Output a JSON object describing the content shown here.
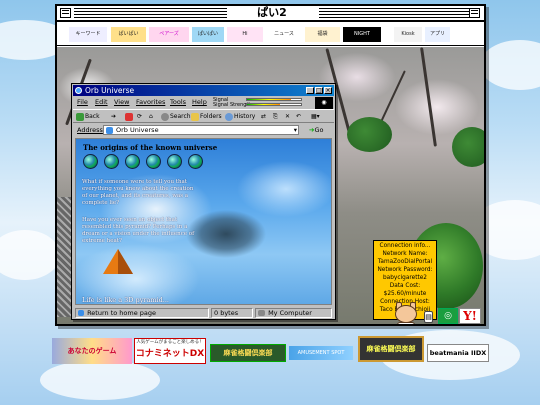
{
  "window": {
    "title": "ぱい2"
  },
  "top_banners": [
    "キーワード",
    "ぱいぱい",
    "ペアーズ",
    "ぱいぱい",
    "Hi",
    "ニュース",
    "福袋",
    "NIGHT",
    "Kiosk",
    "アプリ"
  ],
  "browser": {
    "title": "Orb Universe",
    "menu": [
      "File",
      "Edit",
      "View",
      "Favorites",
      "Tools",
      "Help"
    ],
    "signal": {
      "label1": "Signal",
      "label2": "Signal Strength",
      "signal_level": 0.82,
      "strength_level": 0.62
    },
    "toolbar": {
      "back": "Back",
      "stop": "",
      "search": "Search",
      "folders": "Folders",
      "history": "History"
    },
    "address": {
      "label": "Address",
      "value": "Orb Universe",
      "go": "Go"
    },
    "content": {
      "heading": "The origins of the known universe",
      "globe_count": 6,
      "paragraphs": [
        "What if someone were to tell you that everything you knew about the creation of our planet, and its creatures, was a complete lie?",
        "Have you ever seen an object that resembled this pyramid? Perhaps in a dream or a vision under the influence of extreme heat?",
        "Life is like a 3D pyramid..."
      ]
    },
    "status": {
      "home": "Return to home page",
      "bytes": "0 bytes",
      "zone": "My Computer"
    }
  },
  "info_box": {
    "lines": [
      "Connection info...",
      "Network Name:",
      "TamaZooDialPortal",
      "Network Password:",
      "babycigarette2",
      "Data Cost:",
      "$25.60/minute",
      "Connection Host:",
      "Taco Bell Hachioji"
    ]
  },
  "bottom_ads": [
    {
      "label": "あなたのゲーム"
    },
    {
      "label": "人気ゲームがまるごと楽しめる！",
      "sub": "コナミネットDX"
    },
    {
      "label": "麻雀格闘倶楽部"
    },
    {
      "label": "AMUSEMENT SPOT"
    },
    {
      "label": "麻雀格闘倶楽部"
    },
    {
      "label": "beatmania IIDX"
    }
  ],
  "colors": {
    "accent_title": "#000080",
    "info_bg": "#ffc800"
  }
}
